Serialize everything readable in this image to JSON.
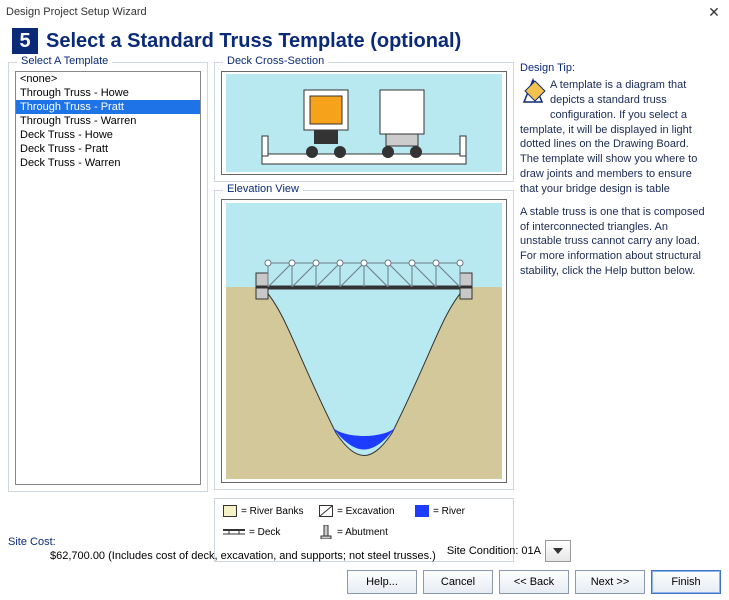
{
  "window": {
    "title": "Design Project Setup Wizard"
  },
  "step": {
    "number": "5",
    "title": "Select a Standard Truss Template (optional)"
  },
  "left": {
    "title": "Select A Template",
    "items": [
      {
        "label": "<none>",
        "selected": false
      },
      {
        "label": "Through Truss - Howe",
        "selected": false
      },
      {
        "label": "Through Truss - Pratt",
        "selected": true
      },
      {
        "label": "Through Truss - Warren",
        "selected": false
      },
      {
        "label": "Deck Truss - Howe",
        "selected": false
      },
      {
        "label": "Deck Truss - Pratt",
        "selected": false
      },
      {
        "label": "Deck Truss - Warren",
        "selected": false
      }
    ]
  },
  "deck": {
    "title": "Deck Cross-Section"
  },
  "elev": {
    "title": "Elevation View"
  },
  "legend": {
    "items": {
      "banks": "= River Banks",
      "excavation": "= Excavation",
      "river": "= River",
      "deck": "= Deck",
      "abutment": "= Abutment"
    }
  },
  "tip": {
    "title": "Design Tip:",
    "p1": "A template is a diagram that depicts a standard truss configuration. If you select a template, it will be displayed in light dotted lines on the Drawing Board. The template will show you where to draw joints and members to ensure that your bridge design is table",
    "p2": "A stable truss is one that is composed of interconnected triangles. An unstable truss cannot carry any load. For more information about structural stability, click the Help button below."
  },
  "cost": {
    "label": "Site Cost:",
    "value": "$62,700.00  (Includes cost of deck, excavation, and supports; not steel trusses.)"
  },
  "site_condition": {
    "label": "Site Condition: 01A"
  },
  "buttons": {
    "help": "Help...",
    "cancel": "Cancel",
    "back": "<< Back",
    "next": "Next >>",
    "finish": "Finish"
  }
}
